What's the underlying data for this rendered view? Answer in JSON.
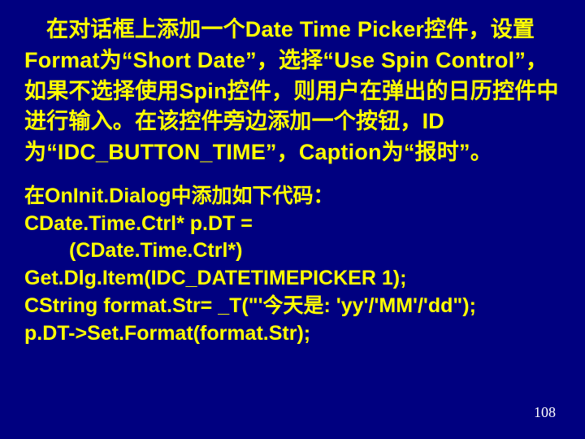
{
  "slide": {
    "para1": "在对话框上添加一个Date Time Picker控件，设置Format为“Short Date”，选择“Use Spin Control”，如果不选择使用Spin控件，则用户在弹出的日历控件中进行输入。在该控件旁边添加一个按钮，ID为“IDC_BUTTON_TIME”，Caption为“报时”。",
    "para2_line1": "在OnInit.Dialog中添加如下代码：",
    "para2_line2": "CDate.Time.Ctrl* p.DT =",
    "para2_line3": "(CDate.Time.Ctrl*)",
    "para2_line4": "Get.Dlg.Item(IDC_DATETIMEPICKER 1);",
    "para2_line5": "CString format.Str= _T(\"'今天是: 'yy'/'MM'/'dd\");",
    "para2_line6": "p.DT->Set.Format(format.Str);",
    "page_number": "108"
  }
}
